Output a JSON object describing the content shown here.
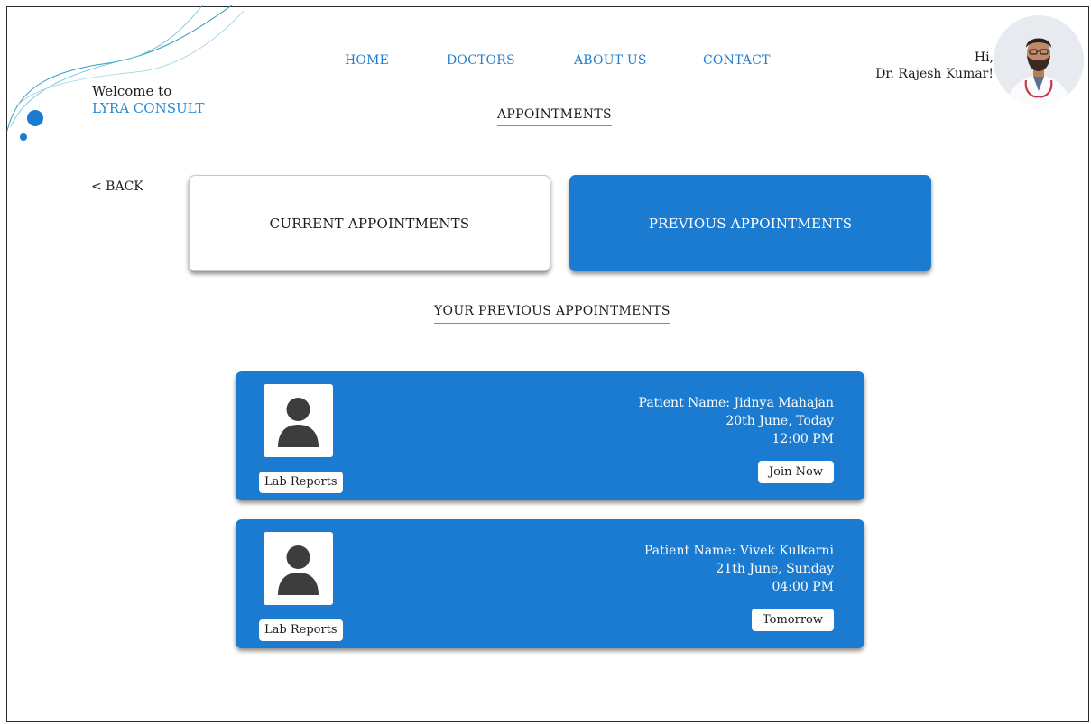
{
  "brand": {
    "welcome": "Welcome to",
    "name": "LYRA CONSULT"
  },
  "nav": {
    "home": "HOME",
    "doctors": "DOCTORS",
    "about": "ABOUT US",
    "contact": "CONTACT"
  },
  "user": {
    "hi": "Hi,",
    "name": "Dr. Rajesh Kumar!"
  },
  "page_title": "APPOINTMENTS",
  "back_label": "< BACK",
  "tabs": {
    "current": "CURRENT APPOINTMENTS",
    "previous": "PREVIOUS APPOINTMENTS"
  },
  "section_title": "YOUR PREVIOUS APPOINTMENTS",
  "appointments": [
    {
      "patient": "Patient Name: Jidnya Mahajan",
      "date": "20th June, Today",
      "time": "12:00 PM",
      "lab_label": "Lab Reports",
      "action_label": "Join Now"
    },
    {
      "patient": "Patient Name: Vivek Kulkarni",
      "date": "21th June, Sunday",
      "time": "04:00 PM",
      "lab_label": "Lab Reports",
      "action_label": "Tomorrow"
    }
  ],
  "colors": {
    "accent": "#1b7bd0",
    "nav_link": "#1f7fd1",
    "brand_name": "#2a8bd4",
    "text": "#1b1b1b"
  },
  "icons": {
    "patient": "user-silhouette-icon"
  }
}
